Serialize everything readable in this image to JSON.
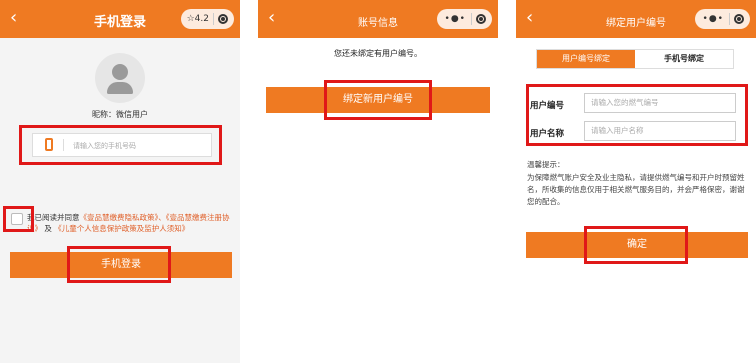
{
  "screens": {
    "login": {
      "title": "手机登录",
      "rating": "4.2",
      "nickname": "昵称：微信用户",
      "phone_placeholder": "请输入您的手机号码",
      "agreement_prefix": "我已阅读并同意",
      "agreement_link1": "《壹品慧缴费隐私政策》、《壹品慧缴费注册协议》",
      "agreement_and": "及",
      "agreement_link2": "《儿童个人信息保护政策及监护人须知》",
      "login_button": "手机登录"
    },
    "account_info": {
      "title": "账号信息",
      "notice": "您还未绑定有用户编号。",
      "bind_button": "绑定新用户编号"
    },
    "bind_user": {
      "title": "绑定用户编号",
      "tabs": [
        "用户编号绑定",
        "手机号绑定"
      ],
      "fields": [
        {
          "label": "用户编号",
          "placeholder": "请输入您的燃气编号"
        },
        {
          "label": "用户名称",
          "placeholder": "请输入用户名称"
        }
      ],
      "tips_title": "温馨提示：",
      "tips_body": "为保障燃气账户安全及业主隐私，请提供燃气编号和开户时预留姓名，所收集的信息仅用于相关燃气服务目的，并会严格保密，谢谢您的配合。",
      "confirm_button": "确定"
    }
  },
  "colors": {
    "accent": "#ef7a22",
    "highlight": "#e01818"
  }
}
